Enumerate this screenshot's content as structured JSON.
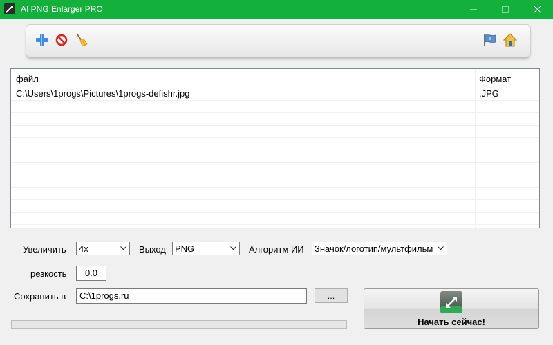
{
  "window": {
    "title": "AI PNG Enlarger PRO"
  },
  "toolbar": {
    "add_icon": "plus-icon",
    "remove_icon": "prohibited-icon",
    "clear_icon": "broom-icon",
    "flag_icon": "flag-icon",
    "home_icon": "home-icon"
  },
  "file_list": {
    "columns": [
      "файл",
      "Формат"
    ],
    "rows": [
      {
        "file": "C:\\Users\\1progs\\Pictures\\1progs-defishr.jpg",
        "format": ".JPG"
      }
    ]
  },
  "options": {
    "scale_label": "Увеличить",
    "scale_value": "4x",
    "output_label": "Выход",
    "output_value": "PNG",
    "algorithm_label": "Алгоритм ИИ",
    "algorithm_value": "Значок/логотип/мультфильм",
    "sharpness_label": "резкость",
    "sharpness_value": "0.0",
    "save_label": "Сохранить в",
    "save_path": "C:\\1progs.ru",
    "browse_label": "..."
  },
  "progress": {
    "value": 0
  },
  "start_button": {
    "label": "Начать сейчас!"
  },
  "colors": {
    "titlebar": "#13b13b",
    "progress_fill": "#06b025"
  }
}
